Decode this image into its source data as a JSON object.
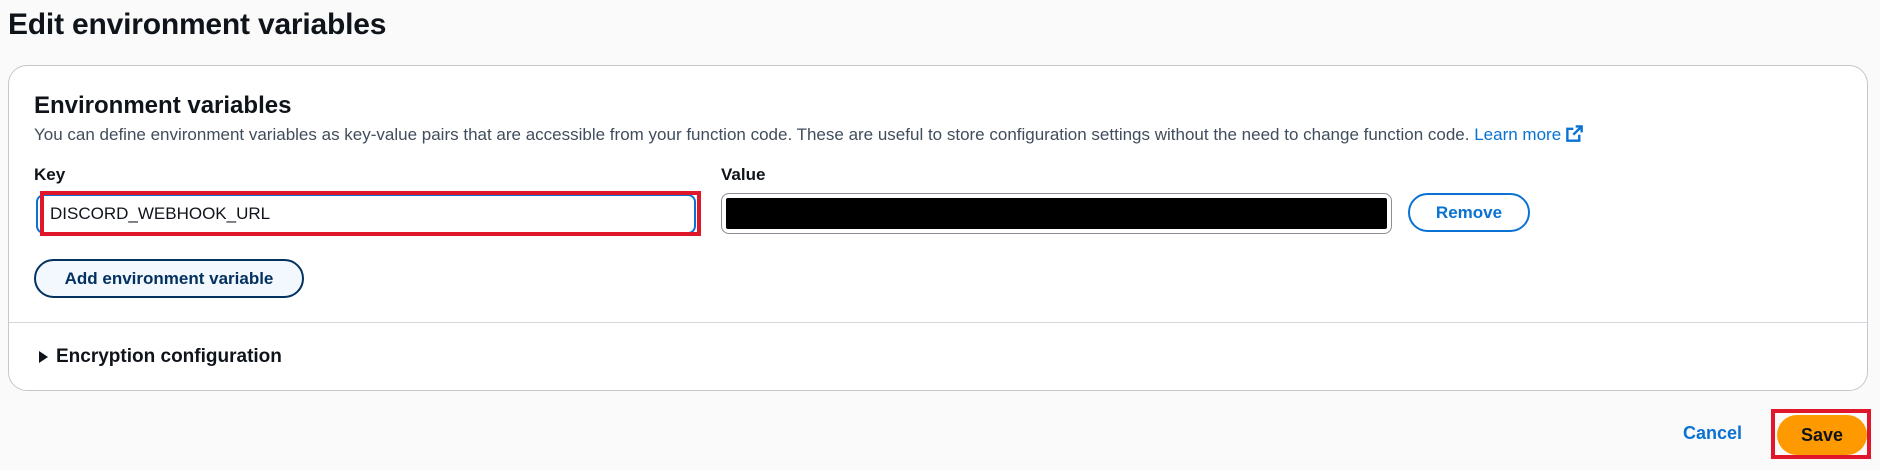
{
  "page": {
    "title": "Edit environment variables"
  },
  "section": {
    "title": "Environment variables",
    "description": "You can define environment variables as key-value pairs that are accessible from your function code. These are useful to store configuration settings without the need to change function code.",
    "learn_more": "Learn more",
    "external_icon": "external-link-icon"
  },
  "variables": {
    "key_label": "Key",
    "value_label": "Value",
    "rows": [
      {
        "key": "DISCORD_WEBHOOK_URL",
        "value_redacted": true
      }
    ],
    "remove_label": "Remove",
    "add_label": "Add environment variable"
  },
  "encryption": {
    "label": "Encryption configuration",
    "icon": "caret-right-icon"
  },
  "footer": {
    "cancel_label": "Cancel",
    "save_label": "Save"
  },
  "colors": {
    "accent": "#0972d3",
    "primary_button": "#ff9900",
    "highlight": "#e0162b",
    "redaction": "#000000"
  }
}
